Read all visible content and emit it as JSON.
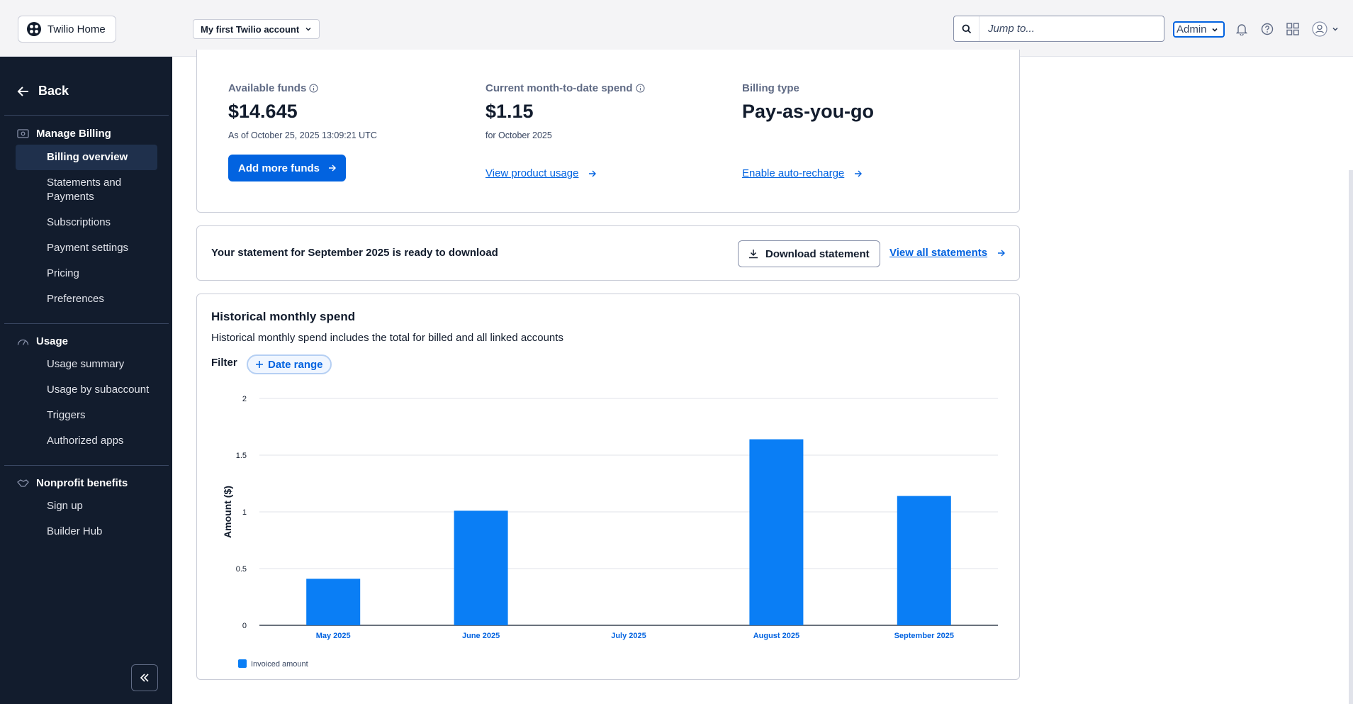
{
  "topbar": {
    "home_label": "Twilio Home",
    "account_label": "My first Twilio account",
    "search_placeholder": "Jump to...",
    "role_value": "Admin",
    "icons": [
      "bell-icon",
      "help-icon",
      "apps-grid-icon",
      "user-icon"
    ]
  },
  "sidebar": {
    "back_label": "Back",
    "sections": [
      {
        "title": "Manage Billing",
        "icon": "billing-icon"
      },
      {
        "title": "Usage",
        "icon": "gauge-icon"
      },
      {
        "title": "Nonprofit benefits",
        "icon": "handshake-icon"
      }
    ],
    "billing_items": [
      "Billing overview",
      "Statements and Payments",
      "Subscriptions",
      "Payment settings",
      "Pricing",
      "Preferences"
    ],
    "usage_items": [
      "Usage summary",
      "Usage by subaccount",
      "Triggers",
      "Authorized apps"
    ],
    "nonprofit_items": [
      "Sign up",
      "Builder Hub"
    ]
  },
  "summary": {
    "available_funds_label": "Available funds",
    "available_funds_value": "$14.645",
    "available_funds_note": "As of October 25, 2025 13:09:21 UTC",
    "add_funds_label": "Add more funds",
    "mtd_label": "Current month-to-date spend",
    "mtd_value": "$1.15",
    "mtd_note": "for October 2025",
    "view_usage_label": "View product usage",
    "billing_type_label": "Billing type",
    "billing_type_value": "Pay-as-you-go",
    "auto_recharge_label": "Enable auto-recharge"
  },
  "statement": {
    "message": "Your statement for September 2025 is ready to download",
    "download_label": "Download statement",
    "view_all_label": "View all statements"
  },
  "history": {
    "title": "Historical monthly spend",
    "description": "Historical monthly spend includes the total for billed and all linked accounts",
    "filter_label": "Filter",
    "date_range_label": "Date range"
  },
  "colors": {
    "accent": "#0263e0",
    "bar": "#0a7ef5",
    "sidebar_bg": "#121c2d"
  },
  "chart_data": {
    "type": "bar",
    "categories": [
      "May 2025",
      "June 2025",
      "July 2025",
      "August 2025",
      "September 2025"
    ],
    "series": [
      {
        "name": "Invoiced amount",
        "values": [
          0.41,
          1.01,
          0,
          1.64,
          1.14
        ]
      }
    ],
    "ylabel": "Amount ($)",
    "xlabel": "",
    "ylim": [
      0,
      2
    ],
    "yticks": [
      0,
      0.5,
      1,
      1.5,
      2
    ],
    "grid": true,
    "legend": "bottom-left"
  }
}
